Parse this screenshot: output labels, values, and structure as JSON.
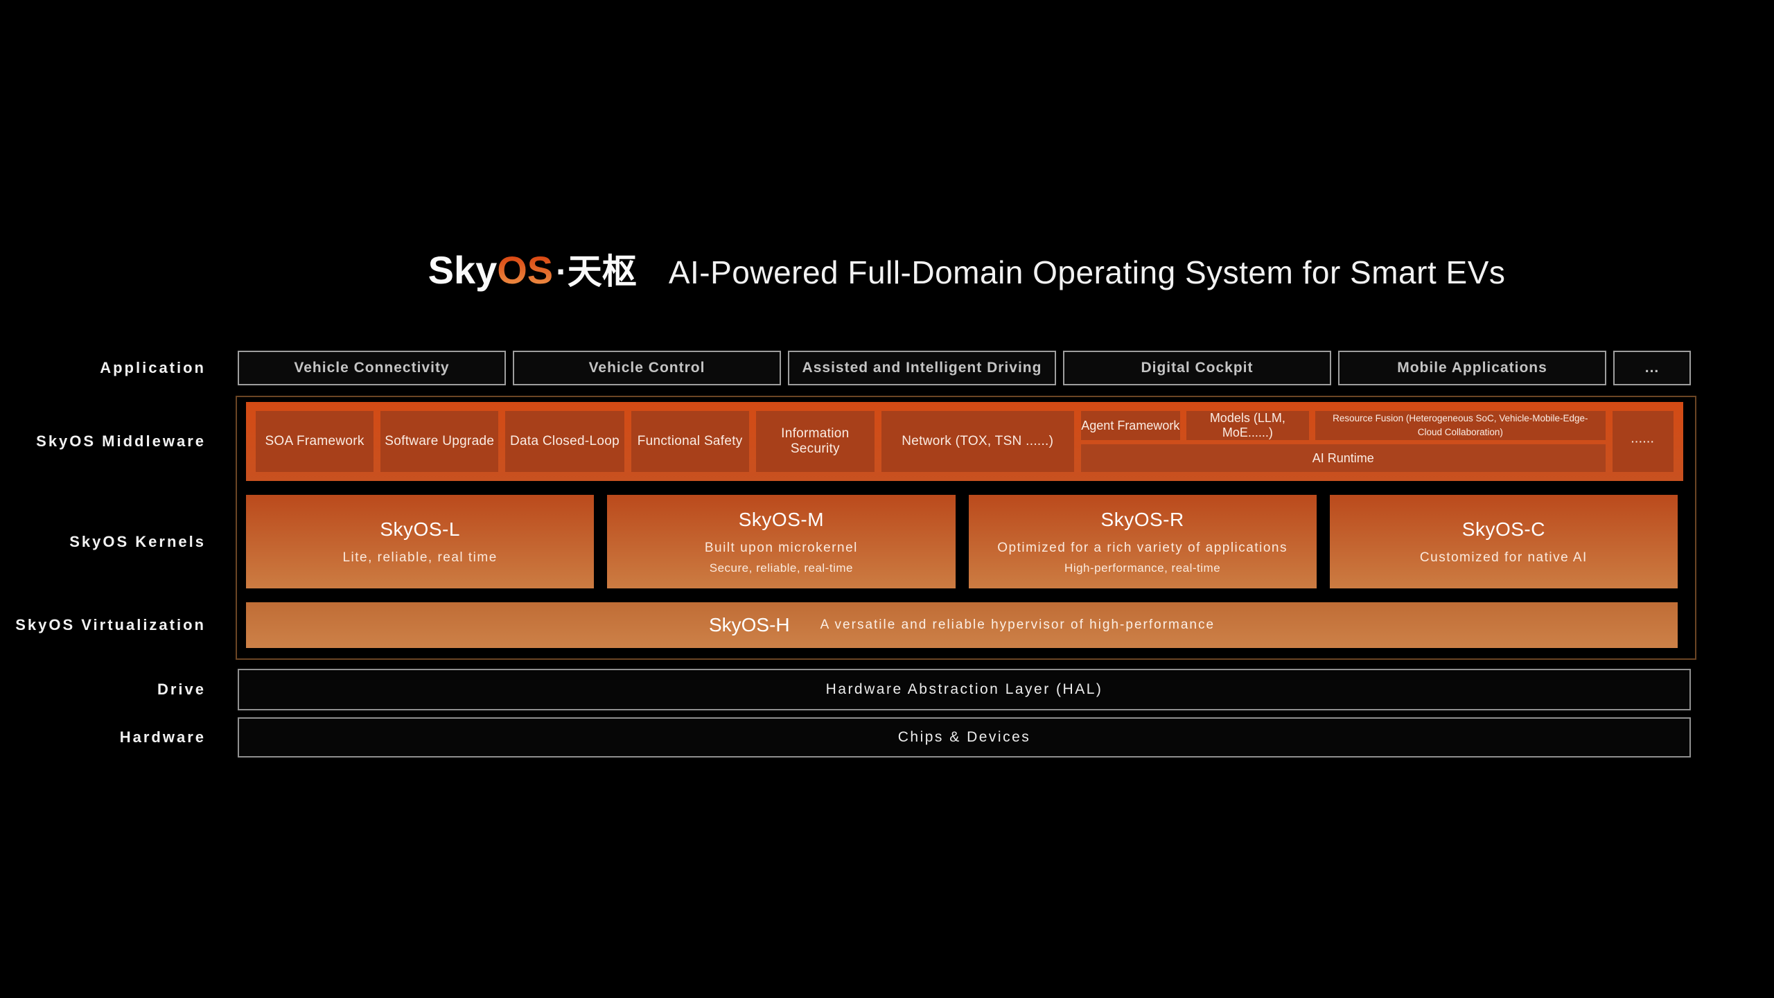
{
  "title": {
    "logo": {
      "sky": "Sky",
      "os": "OS",
      "cn": "·天枢"
    },
    "subtitle": "AI-Powered Full-Domain Operating System for Smart EVs"
  },
  "layers": {
    "application": {
      "label": "Application",
      "items": [
        "Vehicle Connectivity",
        "Vehicle Control",
        "Assisted and Intelligent Driving",
        "Digital Cockpit",
        "Mobile Applications",
        "..."
      ]
    },
    "middleware": {
      "label": "SkyOS Middleware",
      "modules": [
        "SOA Framework",
        "Software Upgrade",
        "Data Closed-Loop",
        "Functional Safety",
        "Information Security",
        "Network (TOX, TSN ......)"
      ],
      "ai": {
        "agent_framework": "Agent Framework",
        "models": "Models (LLM, MoE......)",
        "resource_fusion": "Resource Fusion (Heterogeneous SoC, Vehicle-Mobile-Edge-Cloud Collaboration)",
        "runtime": "AI Runtime",
        "more": "······"
      }
    },
    "kernels": {
      "label": "SkyOS Kernels",
      "items": [
        {
          "name": "SkyOS-L",
          "desc1": "Lite, reliable, real time",
          "desc2": ""
        },
        {
          "name": "SkyOS-M",
          "desc1": "Built upon microkernel",
          "desc2": "Secure, reliable, real-time"
        },
        {
          "name": "SkyOS-R",
          "desc1": "Optimized for a rich variety of applications",
          "desc2": "High-performance, real-time"
        },
        {
          "name": "SkyOS-C",
          "desc1": "Customized for native AI",
          "desc2": ""
        }
      ]
    },
    "virtualization": {
      "label": "SkyOS Virtualization",
      "name": "SkyOS-H",
      "desc": "A versatile and reliable hypervisor of high-performance"
    },
    "drive": {
      "label": "Drive",
      "text": "Hardware Abstraction Layer (HAL)"
    },
    "hardware": {
      "label": "Hardware",
      "text": "Chips & Devices"
    }
  },
  "colors": {
    "background": "#000000",
    "accent_orange": "#d8430f",
    "middleware_bar": "#d04c18",
    "middleware_module": "#a8401a",
    "kernel_gradient_top": "#bb4a1c",
    "kernel_gradient_bottom": "#cc7c42",
    "virtualization_bar": "#c97c43",
    "box_border_gray": "#9e9e9e",
    "container_border": "#6b4524"
  }
}
